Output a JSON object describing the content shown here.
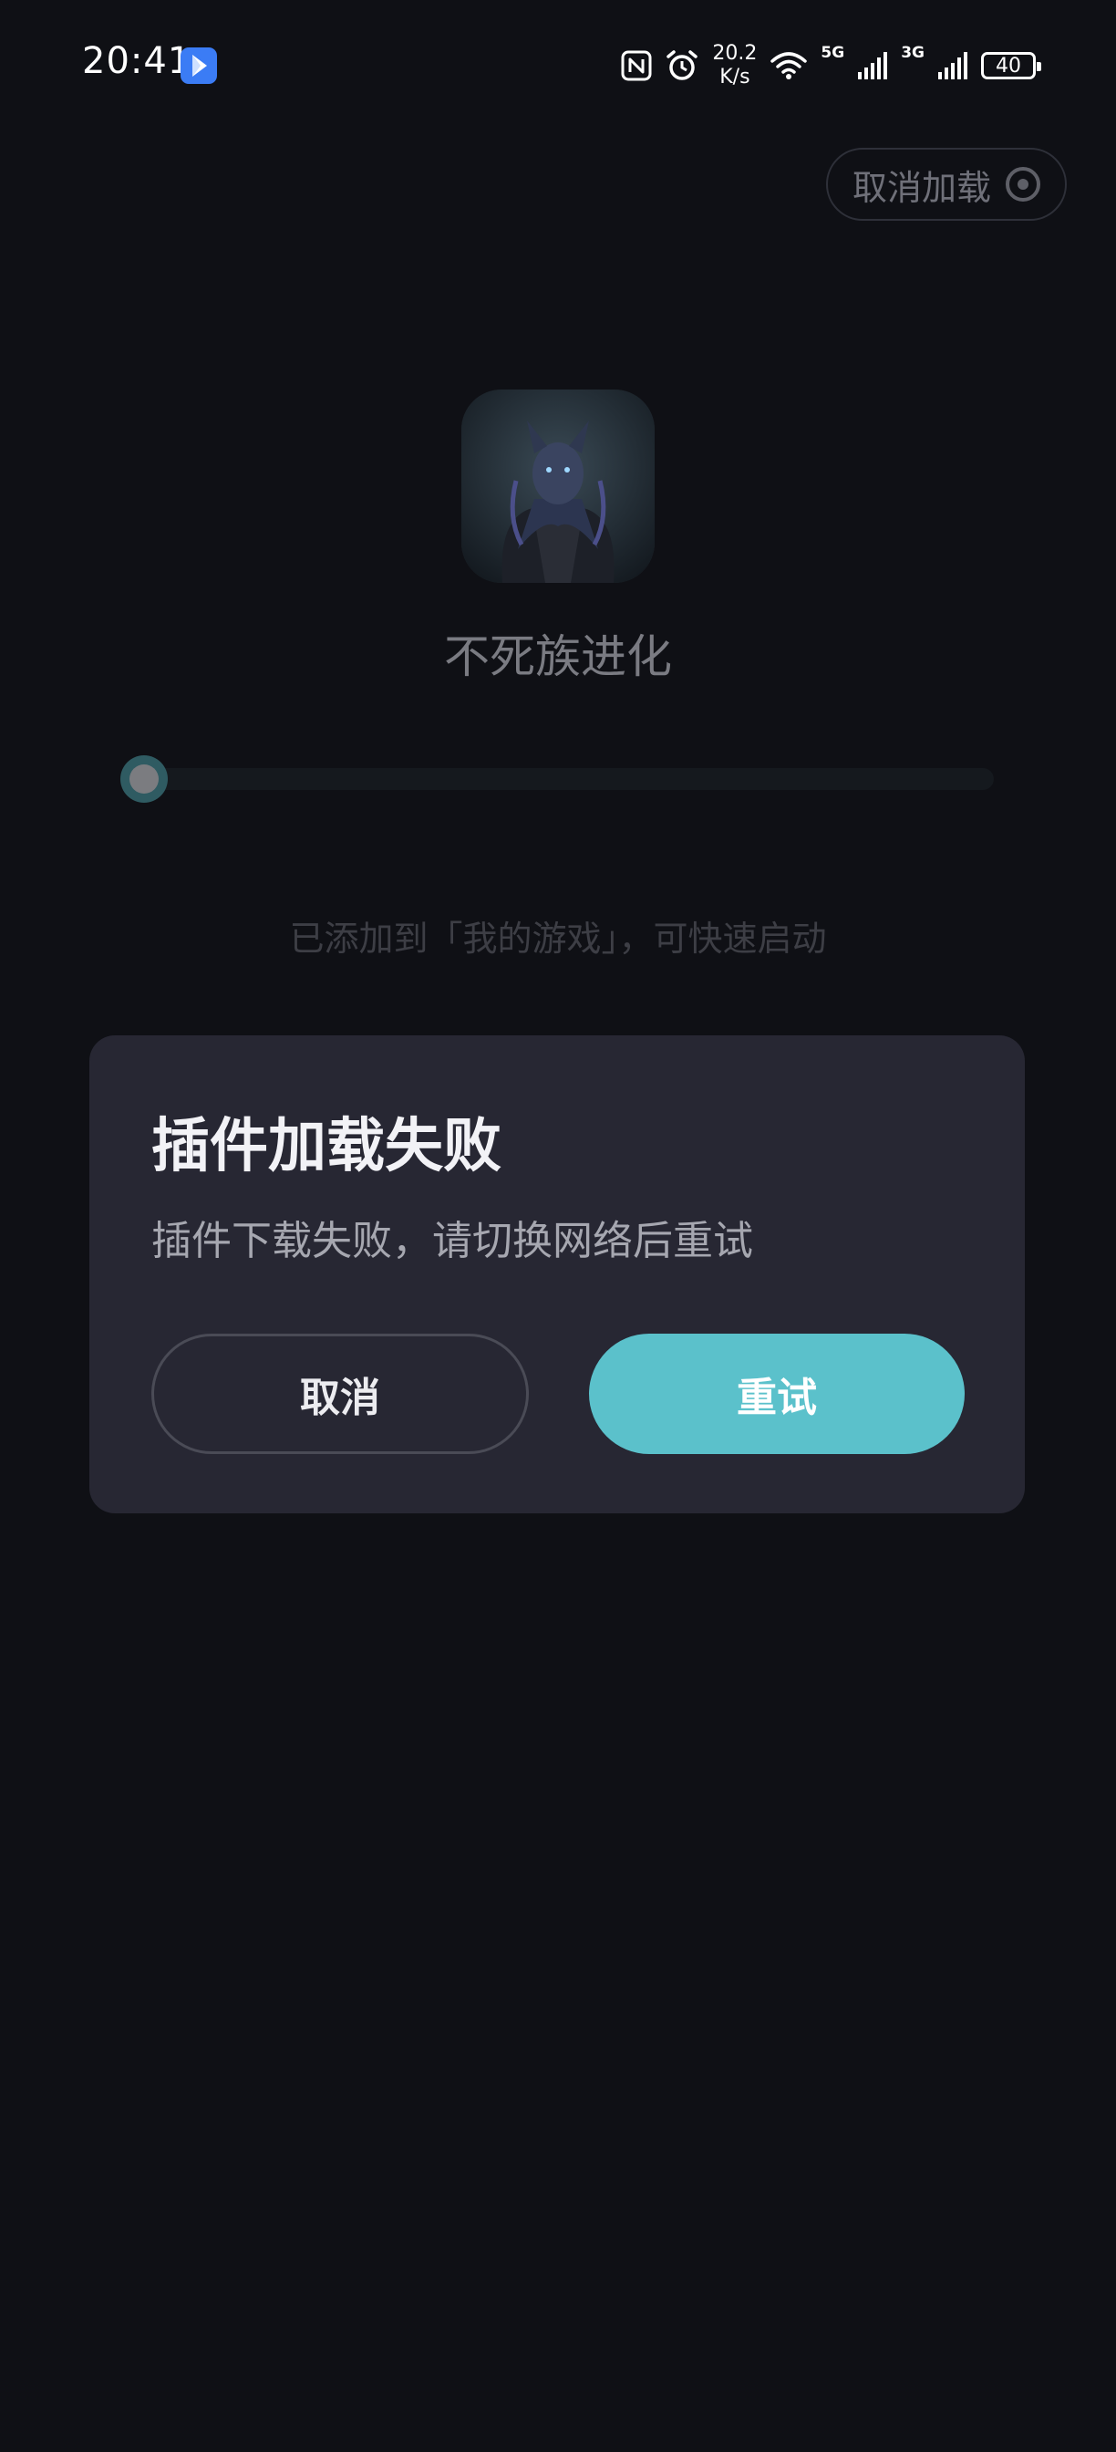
{
  "status_bar": {
    "time": "20:41",
    "net_speed_value": "20.2",
    "net_speed_unit": "K/s",
    "signal_1_label": "5G",
    "signal_2_label": "3G",
    "battery": "40",
    "icons": [
      "app-notification-icon",
      "nfc-icon",
      "alarm-icon",
      "wifi-icon",
      "signal-icon",
      "battery-icon"
    ]
  },
  "top": {
    "cancel_load_label": "取消加载",
    "cancel_load_icon": "stop-circle-icon"
  },
  "game": {
    "name": "不死族进化",
    "progress": 0,
    "hint": "已添加到「我的游戏」，可快速启动"
  },
  "dialog": {
    "title": "插件加载失败",
    "message": "插件下载失败，请切换网络后重试",
    "cancel_label": "取消",
    "retry_label": "重试"
  },
  "colors": {
    "background": "#0f1015",
    "dialog_bg": "#272733",
    "accent": "#5bc1cb"
  }
}
